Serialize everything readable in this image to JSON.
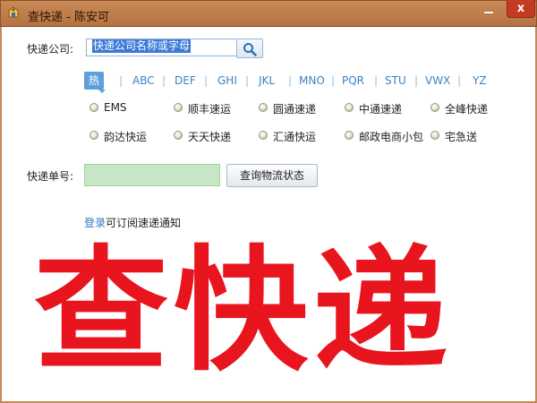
{
  "window": {
    "title": "查快递 - 陈安可",
    "close_glyph": "x"
  },
  "search": {
    "label": "快递公司:",
    "placeholder": "快递公司名称或字母"
  },
  "tabs": [
    {
      "label": "热门",
      "active": true
    },
    {
      "label": "ABC"
    },
    {
      "label": "DEF"
    },
    {
      "label": "GHI"
    },
    {
      "label": "JKL"
    },
    {
      "label": "MNO"
    },
    {
      "label": "PQR"
    },
    {
      "label": "STU"
    },
    {
      "label": "VWX"
    },
    {
      "label": "YZ"
    }
  ],
  "tab_separator": "|",
  "couriers": [
    [
      "EMS",
      "顺丰速运",
      "圆通速递",
      "中通速递",
      "全峰快递"
    ],
    [
      "韵达快运",
      "天天快递",
      "汇通快运",
      "邮政电商小包",
      "宅急送"
    ]
  ],
  "tracking": {
    "label": "快递单号:",
    "value": "",
    "button": "查询物流状态"
  },
  "login": {
    "link": "登录",
    "rest": "可订阅速递通知"
  },
  "banner": {
    "text": "查快递",
    "color": "#e8141e"
  }
}
